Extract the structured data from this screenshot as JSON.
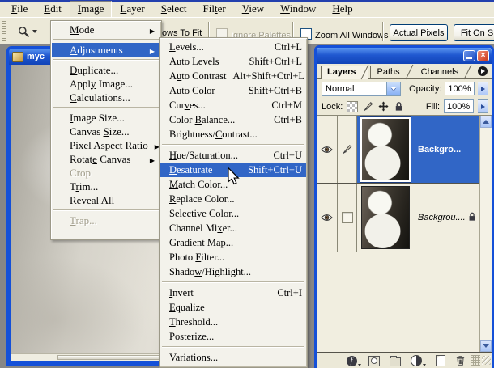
{
  "colors": {
    "chrome": "#ECE9D8",
    "workspace_gray": "#868686",
    "menu_bg": "#F3F2EB",
    "highlight_blue": "#3166C6",
    "window_border_blue": "#1450D8",
    "titlebar_gradient_top": "#5A96F0",
    "titlebar_gradient_bottom": "#1143B8",
    "close_button_red": "#CC3818",
    "disabled_text": "#A29E8C"
  },
  "menubar": {
    "items": [
      {
        "label": "File",
        "u": 0
      },
      {
        "label": "Edit",
        "u": 0
      },
      {
        "label": "Image",
        "u": 0,
        "active": true
      },
      {
        "label": "Layer",
        "u": 0
      },
      {
        "label": "Select",
        "u": 0
      },
      {
        "label": "Filter",
        "u": 3
      },
      {
        "label": "View",
        "u": 0
      },
      {
        "label": "Window",
        "u": 0
      },
      {
        "label": "Help",
        "u": 0
      }
    ]
  },
  "options_bar": {
    "tool_icon": "zoom-tool-icon",
    "resize_windows_label_partial": "ows To Fit",
    "ignore_palettes_label": "Ignore Palettes",
    "ignore_palettes_disabled": true,
    "zoom_all_windows_label": "Zoom All Windows",
    "actual_pixels_button": "Actual Pixels",
    "fit_on_screen_button_partial": "Fit On S"
  },
  "document_window": {
    "title_partial": "myc"
  },
  "image_menu": {
    "items": [
      {
        "label": "Mode",
        "u": 0,
        "submenu": true
      },
      {
        "sep": true
      },
      {
        "label": "Adjustments",
        "u": 0,
        "submenu": true,
        "highlighted": true
      },
      {
        "sep": true
      },
      {
        "label": "Duplicate...",
        "u": 0
      },
      {
        "label": "Apply Image...",
        "u": 4
      },
      {
        "label": "Calculations...",
        "u": 0
      },
      {
        "sep": true
      },
      {
        "label": "Image Size...",
        "u": 0
      },
      {
        "label": "Canvas Size...",
        "u": 7
      },
      {
        "label": "Pixel Aspect Ratio",
        "u": 2,
        "submenu": true
      },
      {
        "label": "Rotate Canvas",
        "u": 5,
        "submenu": true
      },
      {
        "label": "Crop",
        "disabled": true
      },
      {
        "label": "Trim...",
        "u": 1
      },
      {
        "label": "Reveal All",
        "u": 2
      },
      {
        "sep": true
      },
      {
        "label": "Trap...",
        "u": 0,
        "disabled": true
      }
    ]
  },
  "adjustments_submenu": {
    "items": [
      {
        "label": "Levels...",
        "u": 0,
        "shortcut": "Ctrl+L"
      },
      {
        "label": "Auto Levels",
        "u": 0,
        "shortcut": "Shift+Ctrl+L"
      },
      {
        "label": "Auto Contrast",
        "u": 1,
        "shortcut": "Alt+Shift+Ctrl+L"
      },
      {
        "label": "Auto Color",
        "u": 3,
        "shortcut": "Shift+Ctrl+B"
      },
      {
        "label": "Curves...",
        "u": 3,
        "shortcut": "Ctrl+M"
      },
      {
        "label": "Color Balance...",
        "u": 6,
        "shortcut": "Ctrl+B"
      },
      {
        "label": "Brightness/Contrast...",
        "u": 11
      },
      {
        "sep": true
      },
      {
        "label": "Hue/Saturation...",
        "u": 0,
        "shortcut": "Ctrl+U"
      },
      {
        "label": "Desaturate",
        "u": 0,
        "shortcut": "Shift+Ctrl+U",
        "highlighted": true
      },
      {
        "label": "Match Color...",
        "u": 0
      },
      {
        "label": "Replace Color...",
        "u": 0
      },
      {
        "label": "Selective Color...",
        "u": 0
      },
      {
        "label": "Channel Mixer...",
        "u": 10
      },
      {
        "label": "Gradient Map...",
        "u": 9
      },
      {
        "label": "Photo Filter...",
        "u": 6
      },
      {
        "label": "Shadow/Highlight...",
        "u": 5
      },
      {
        "sep": true
      },
      {
        "label": "Invert",
        "u": 0,
        "shortcut": "Ctrl+I"
      },
      {
        "label": "Equalize",
        "u": 0
      },
      {
        "label": "Threshold...",
        "u": 0
      },
      {
        "label": "Posterize...",
        "u": 0
      },
      {
        "sep": true
      },
      {
        "label": "Variations...",
        "u": 8
      }
    ]
  },
  "layers_palette": {
    "tabs": [
      "Layers",
      "Paths",
      "Channels"
    ],
    "active_tab": "Layers",
    "blend_mode": "Normal",
    "opacity_label": "Opacity:",
    "opacity_value": "100%",
    "lock_label": "Lock:",
    "lock_icons": [
      "lock-transparency-icon",
      "lock-paint-icon",
      "lock-move-icon",
      "lock-all-icon"
    ],
    "fill_label": "Fill:",
    "fill_value": "100%",
    "layers": [
      {
        "name": "Backgro...",
        "selected": true,
        "visible": true,
        "painting": true,
        "locked": false,
        "italic": false
      },
      {
        "name": "Backgrou....",
        "selected": false,
        "visible": true,
        "painting": false,
        "locked": true,
        "italic": true
      }
    ],
    "bottom_icons": [
      "layer-style-icon",
      "layer-mask-icon",
      "new-group-icon",
      "adjustment-layer-icon",
      "new-layer-icon",
      "delete-layer-icon"
    ],
    "window_buttons": [
      "minimize",
      "close"
    ]
  }
}
